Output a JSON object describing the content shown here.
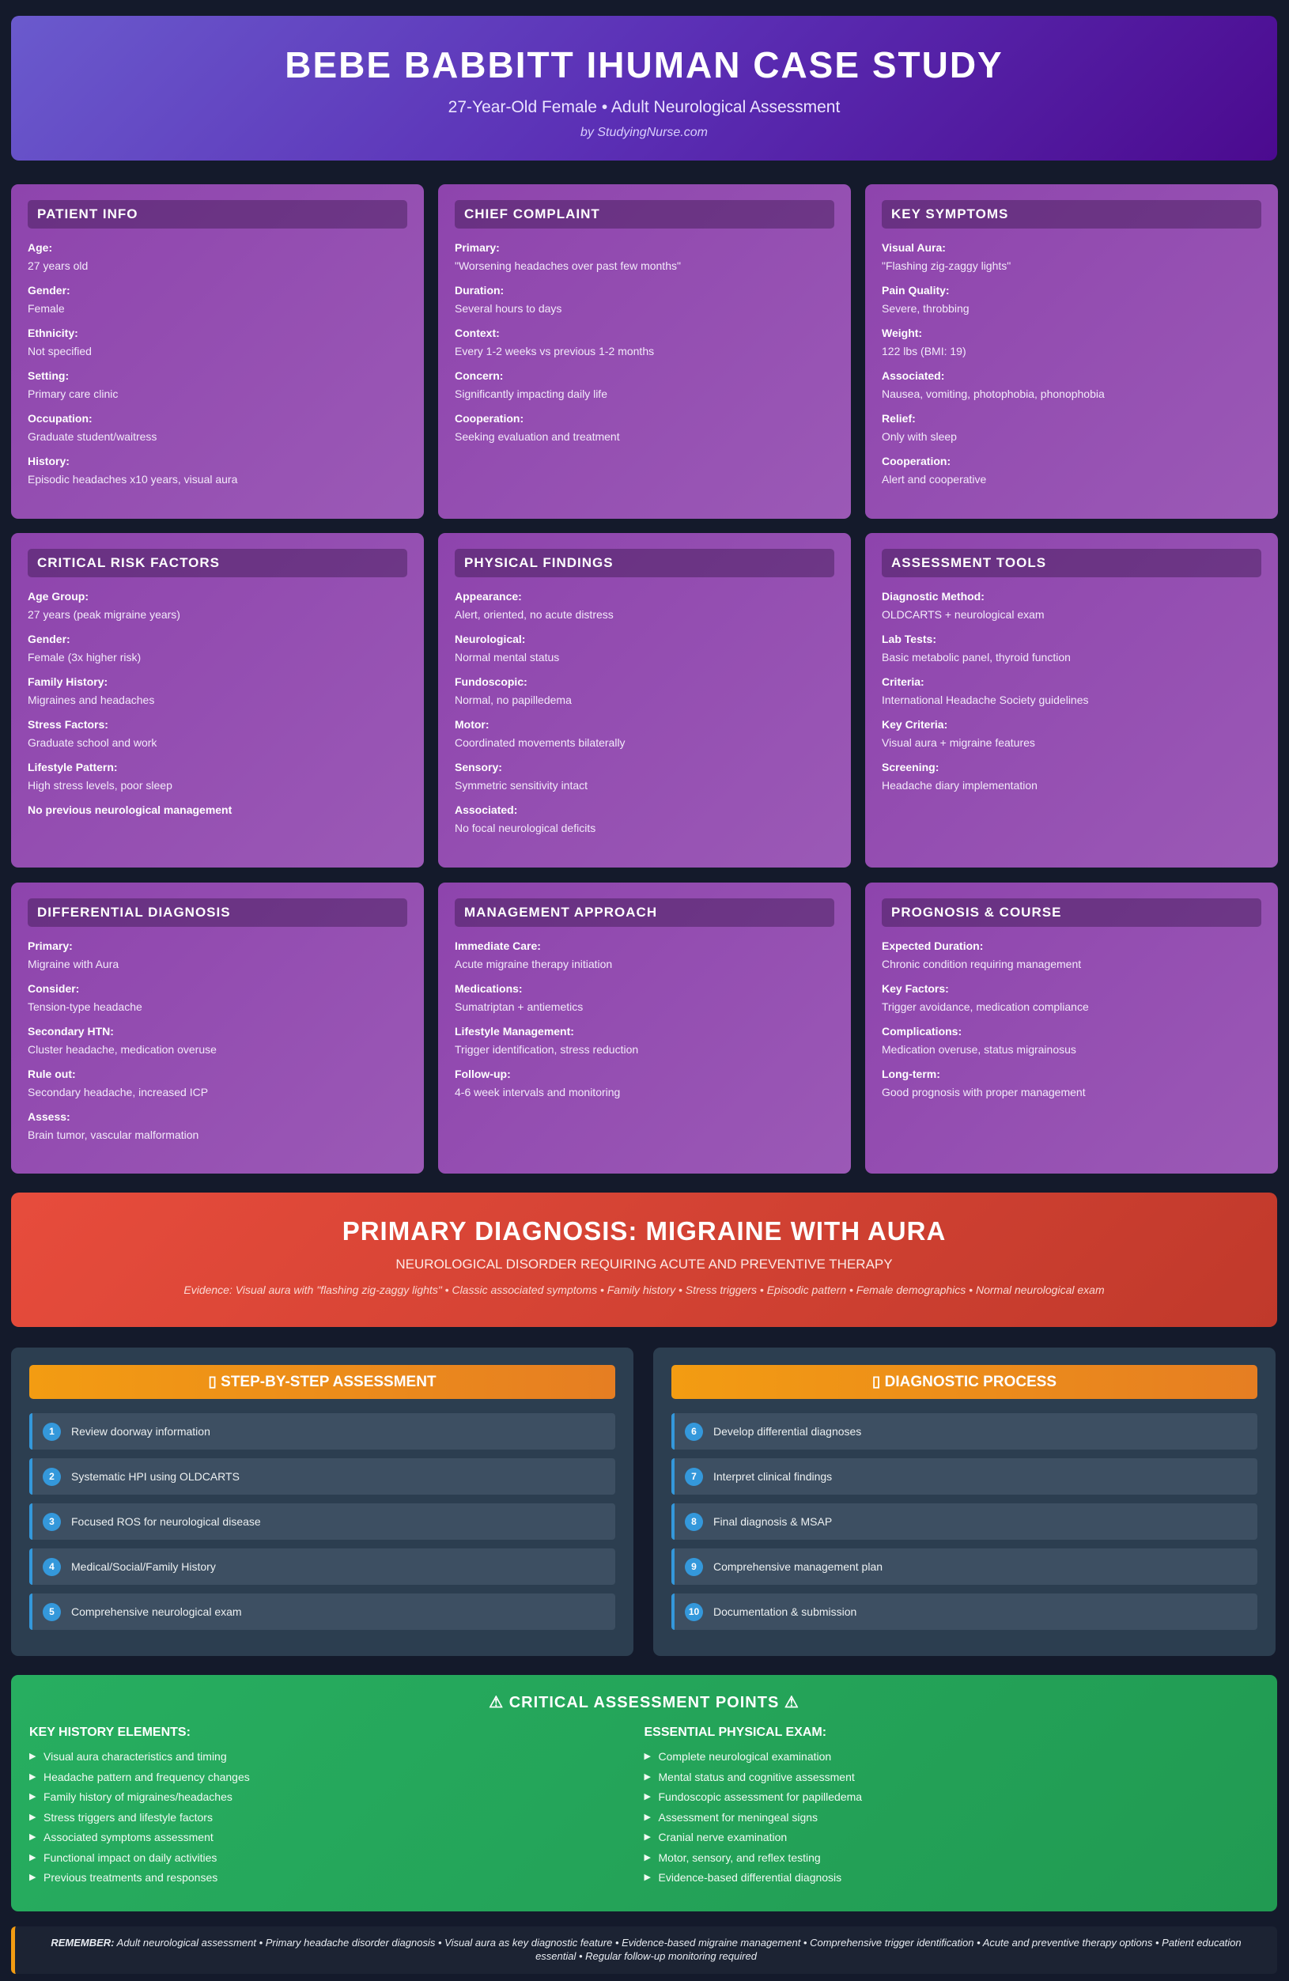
{
  "header": {
    "title": "BEBE BABBITT IHUMAN CASE STUDY",
    "subtitle": "27-Year-Old Female • Adult Neurological Assessment",
    "byline": "by StudyingNurse.com"
  },
  "cards": [
    {
      "title": "PATIENT INFO",
      "fields": [
        {
          "label": "Age:",
          "value": "27 years old"
        },
        {
          "label": "Gender:",
          "value": "Female"
        },
        {
          "label": "Ethnicity:",
          "value": "Not specified"
        },
        {
          "label": "Setting:",
          "value": "Primary care clinic"
        },
        {
          "label": "Occupation:",
          "value": "Graduate student/waitress"
        },
        {
          "label": "History:",
          "value": "Episodic headaches x10 years, visual aura"
        }
      ]
    },
    {
      "title": "CHIEF COMPLAINT",
      "fields": [
        {
          "label": "Primary:",
          "value": "\"Worsening headaches over past few months\""
        },
        {
          "label": "Duration:",
          "value": "Several hours to days"
        },
        {
          "label": "Context:",
          "value": "Every 1-2 weeks vs previous 1-2 months"
        },
        {
          "label": "Concern:",
          "value": "Significantly impacting daily life"
        },
        {
          "label": "Cooperation:",
          "value": "Seeking evaluation and treatment"
        }
      ]
    },
    {
      "title": "KEY SYMPTOMS",
      "fields": [
        {
          "label": "Visual Aura:",
          "value": "\"Flashing zig-zaggy lights\""
        },
        {
          "label": "Pain Quality:",
          "value": "Severe, throbbing"
        },
        {
          "label": "Weight:",
          "value": "122 lbs (BMI: 19)"
        },
        {
          "label": "Associated:",
          "value": "Nausea, vomiting, photophobia, phonophobia"
        },
        {
          "label": "Relief:",
          "value": "Only with sleep"
        },
        {
          "label": "Cooperation:",
          "value": "Alert and cooperative"
        }
      ]
    },
    {
      "title": "CRITICAL RISK FACTORS",
      "fields": [
        {
          "label": "Age Group:",
          "value": "27 years (peak migraine years)"
        },
        {
          "label": "Gender:",
          "value": "Female (3x higher risk)"
        },
        {
          "label": "Family History:",
          "value": "Migraines and headaches"
        },
        {
          "label": "Stress Factors:",
          "value": "Graduate school and work"
        },
        {
          "label": "Lifestyle Pattern:",
          "value": "High stress levels, poor sleep"
        }
      ],
      "note": "No previous neurological management"
    },
    {
      "title": "PHYSICAL FINDINGS",
      "fields": [
        {
          "label": "Appearance:",
          "value": "Alert, oriented, no acute distress"
        },
        {
          "label": "Neurological:",
          "value": "Normal mental status"
        },
        {
          "label": "Fundoscopic:",
          "value": "Normal, no papilledema"
        },
        {
          "label": "Motor:",
          "value": "Coordinated movements bilaterally"
        },
        {
          "label": "Sensory:",
          "value": "Symmetric sensitivity intact"
        },
        {
          "label": "Associated:",
          "value": "No focal neurological deficits"
        }
      ]
    },
    {
      "title": "ASSESSMENT TOOLS",
      "fields": [
        {
          "label": "Diagnostic Method:",
          "value": "OLDCARTS + neurological exam"
        },
        {
          "label": "Lab Tests:",
          "value": "Basic metabolic panel, thyroid function"
        },
        {
          "label": "Criteria:",
          "value": "International Headache Society guidelines"
        },
        {
          "label": "Key Criteria:",
          "value": "Visual aura + migraine features"
        },
        {
          "label": "Screening:",
          "value": "Headache diary implementation"
        }
      ]
    },
    {
      "title": "DIFFERENTIAL DIAGNOSIS",
      "fields": [
        {
          "label": "Primary:",
          "value": "Migraine with Aura"
        },
        {
          "label": "Consider:",
          "value": "Tension-type headache"
        },
        {
          "label": "Secondary HTN:",
          "value": "Cluster headache, medication overuse"
        },
        {
          "label": "Rule out:",
          "value": "Secondary headache, increased ICP"
        },
        {
          "label": "Assess:",
          "value": "Brain tumor, vascular malformation"
        }
      ]
    },
    {
      "title": "MANAGEMENT APPROACH",
      "fields": [
        {
          "label": "Immediate Care:",
          "value": "Acute migraine therapy initiation"
        },
        {
          "label": "Medications:",
          "value": "Sumatriptan + antiemetics"
        },
        {
          "label": "Lifestyle Management:",
          "value": "Trigger identification, stress reduction"
        },
        {
          "label": "Follow-up:",
          "value": "4-6 week intervals and monitoring"
        }
      ]
    },
    {
      "title": "PROGNOSIS & COURSE",
      "fields": [
        {
          "label": "Expected Duration:",
          "value": "Chronic condition requiring management"
        },
        {
          "label": "Key Factors:",
          "value": "Trigger avoidance, medication compliance"
        },
        {
          "label": "Complications:",
          "value": "Medication overuse, status migrainosus"
        },
        {
          "label": "Long-term:",
          "value": "Good prognosis with proper management"
        }
      ]
    }
  ],
  "diagnosis": {
    "title": "PRIMARY DIAGNOSIS: MIGRAINE WITH AURA",
    "subtitle": "NEUROLOGICAL DISORDER REQUIRING ACUTE AND PREVENTIVE THERAPY",
    "evidence": "Evidence: Visual aura with \"flashing zig-zaggy lights\" • Classic associated symptoms • Family history • Stress triggers • Episodic pattern • Female demographics • Normal neurological exam"
  },
  "step_sections": [
    {
      "title": "▯ STEP-BY-STEP ASSESSMENT",
      "steps": [
        {
          "num": "1",
          "text": "Review doorway information"
        },
        {
          "num": "2",
          "text": "Systematic HPI using OLDCARTS"
        },
        {
          "num": "3",
          "text": "Focused ROS for neurological disease"
        },
        {
          "num": "4",
          "text": "Medical/Social/Family History"
        },
        {
          "num": "5",
          "text": "Comprehensive neurological exam"
        }
      ]
    },
    {
      "title": "▯ DIAGNOSTIC PROCESS",
      "steps": [
        {
          "num": "6",
          "text": "Develop differential diagnoses"
        },
        {
          "num": "7",
          "text": "Interpret clinical findings"
        },
        {
          "num": "8",
          "text": "Final diagnosis & MSAP"
        },
        {
          "num": "9",
          "text": "Comprehensive management plan"
        },
        {
          "num": "10",
          "text": "Documentation & submission"
        }
      ]
    }
  ],
  "critical": {
    "title": "⚠ CRITICAL ASSESSMENT POINTS ⚠",
    "columns": [
      {
        "heading": "KEY HISTORY ELEMENTS:",
        "items": [
          "Visual aura characteristics and timing",
          "Headache pattern and frequency changes",
          "Family history of migraines/headaches",
          "Stress triggers and lifestyle factors",
          "Associated symptoms assessment",
          "Functional impact on daily activities",
          "Previous treatments and responses"
        ]
      },
      {
        "heading": "ESSENTIAL PHYSICAL EXAM:",
        "items": [
          "Complete neurological examination",
          "Mental status and cognitive assessment",
          "Fundoscopic assessment for papilledema",
          "Assessment for meningeal signs",
          "Cranial nerve examination",
          "Motor, sensory, and reflex testing",
          "Evidence-based differential diagnosis"
        ]
      }
    ]
  },
  "remember": {
    "label": "REMEMBER:",
    "text": " Adult neurological assessment • Primary headache disorder diagnosis • Visual aura as key diagnostic feature • Evidence-based migraine management • Comprehensive trigger identification • Acute and preventive therapy options • Patient education essential • Regular follow-up monitoring required"
  },
  "colors": {
    "background": "#141a2b",
    "card": "#9b59b6",
    "diagnosis": "#e74c3c",
    "steps_header": "#f39c12",
    "step_accent": "#3498db",
    "critical": "#27ae60"
  }
}
